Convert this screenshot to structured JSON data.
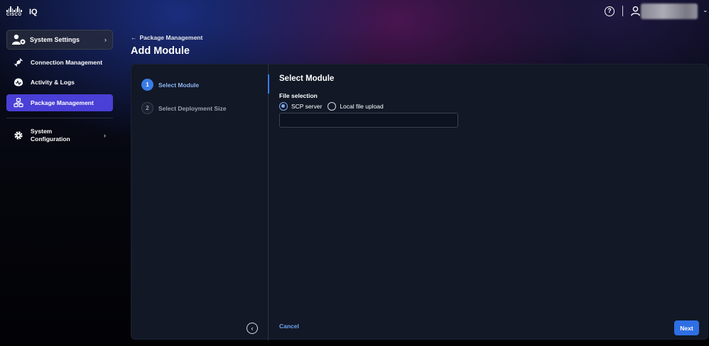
{
  "topbar": {
    "logo_word": "CISCO",
    "logo_suffix": "IQ",
    "help_icon": "help-circle-icon",
    "user_icon": "user-icon",
    "user_menu_chevron": "chevron-down-icon"
  },
  "sidebar": {
    "header": {
      "label": "System Settings",
      "icon": "user-settings-icon"
    },
    "items": [
      {
        "label": "Connection Management",
        "icon": "plug-icon"
      },
      {
        "label": "Activity & Logs",
        "icon": "activity-icon"
      },
      {
        "label": "Package Management",
        "icon": "package-icon",
        "active": true
      },
      {
        "label": "System Configuration",
        "icon": "gear-icon"
      }
    ]
  },
  "breadcrumb": {
    "label": "Package Management"
  },
  "page": {
    "title": "Add Module"
  },
  "wizard": {
    "steps": [
      {
        "number": "1",
        "label": "Select Module",
        "state": "current"
      },
      {
        "number": "2",
        "label": "Select Deployment Size",
        "state": "pending"
      }
    ]
  },
  "form": {
    "section_title": "Select Module",
    "field_label": "File selection",
    "options": [
      {
        "label": "SCP server",
        "checked": true
      },
      {
        "label": "Local file upload",
        "checked": false
      }
    ],
    "input_value": ""
  },
  "footer": {
    "cancel_label": "Cancel",
    "next_label": "Next"
  },
  "colors": {
    "accent_blue": "#2f6fe4",
    "active_nav": "#4a3fd6",
    "panel_bg": "#121826"
  }
}
